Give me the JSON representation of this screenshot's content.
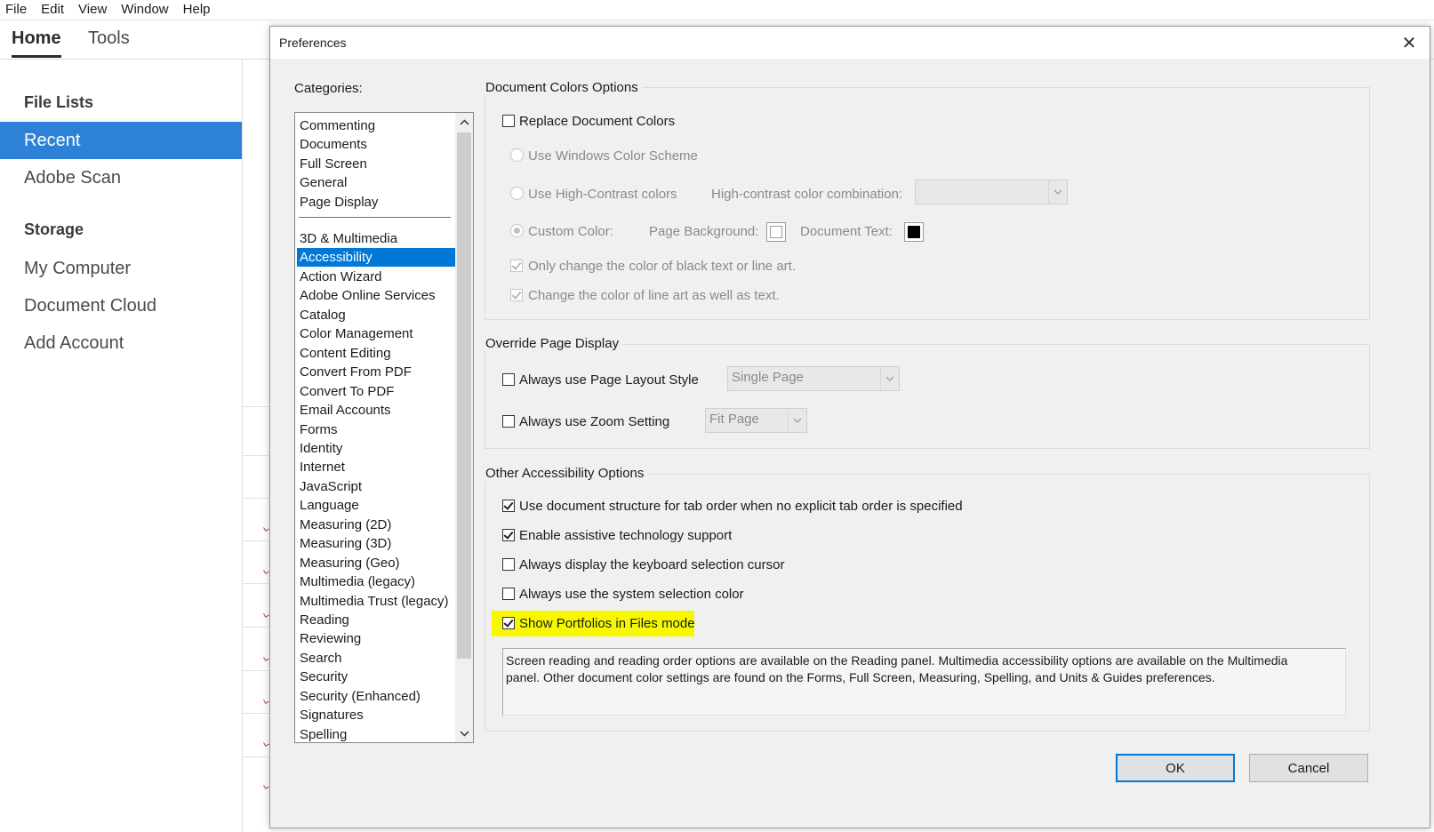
{
  "menubar": {
    "items": [
      "File",
      "Edit",
      "View",
      "Window",
      "Help"
    ]
  },
  "app_tabs": {
    "home": "Home",
    "tools": "Tools"
  },
  "sidebar": {
    "file_lists_heading": "File Lists",
    "recent": "Recent",
    "adobe_scan": "Adobe Scan",
    "storage_heading": "Storage",
    "my_computer": "My Computer",
    "document_cloud": "Document Cloud",
    "add_account": "Add Account",
    "accent_color": "#2d82d7"
  },
  "dialog": {
    "title": "Preferences",
    "close_glyph": "✕",
    "categories_label": "Categories:",
    "categories_top": [
      "Commenting",
      "Documents",
      "Full Screen",
      "General",
      "Page Display"
    ],
    "categories_rest": [
      "3D & Multimedia",
      "Accessibility",
      "Action Wizard",
      "Adobe Online Services",
      "Catalog",
      "Color Management",
      "Content Editing",
      "Convert From PDF",
      "Convert To PDF",
      "Email Accounts",
      "Forms",
      "Identity",
      "Internet",
      "JavaScript",
      "Language",
      "Measuring (2D)",
      "Measuring (3D)",
      "Measuring (Geo)",
      "Multimedia (legacy)",
      "Multimedia Trust (legacy)",
      "Reading",
      "Reviewing",
      "Search",
      "Security",
      "Security (Enhanced)",
      "Signatures",
      "Spelling"
    ],
    "selected_category": "Accessibility",
    "doc_colors": {
      "title": "Document Colors Options",
      "replace": "Replace Document Colors",
      "windows_scheme": "Use Windows Color Scheme",
      "high_contrast": "Use High-Contrast colors",
      "high_contrast_combo_label": "High-contrast color combination:",
      "custom_color": "Custom Color:",
      "page_background": "Page Background:",
      "document_text": "Document Text:",
      "only_black": "Only change the color of black text or line art.",
      "line_art": "Change the color of line art as well as text."
    },
    "override": {
      "title": "Override Page Display",
      "page_layout": "Always use Page Layout Style",
      "page_layout_value": "Single Page",
      "zoom": "Always use Zoom Setting",
      "zoom_value": "Fit Page"
    },
    "other": {
      "title": "Other Accessibility Options",
      "tab_order": "Use document structure for tab order when no explicit tab order is specified",
      "assistive": "Enable assistive technology support",
      "keyboard_cursor": "Always display the keyboard selection cursor",
      "system_color": "Always use the system selection color",
      "portfolios": "Show Portfolios in Files mode",
      "info_line1": "Screen reading and reading order options are available on the Reading panel. Multimedia accessibility options are available on the Multimedia",
      "info_line2": "panel. Other document color settings are found on the Forms, Full Screen, Measuring, Spelling, and Units & Guides preferences."
    },
    "ok": "OK",
    "cancel": "Cancel",
    "highlight_color": "#f7f700"
  }
}
